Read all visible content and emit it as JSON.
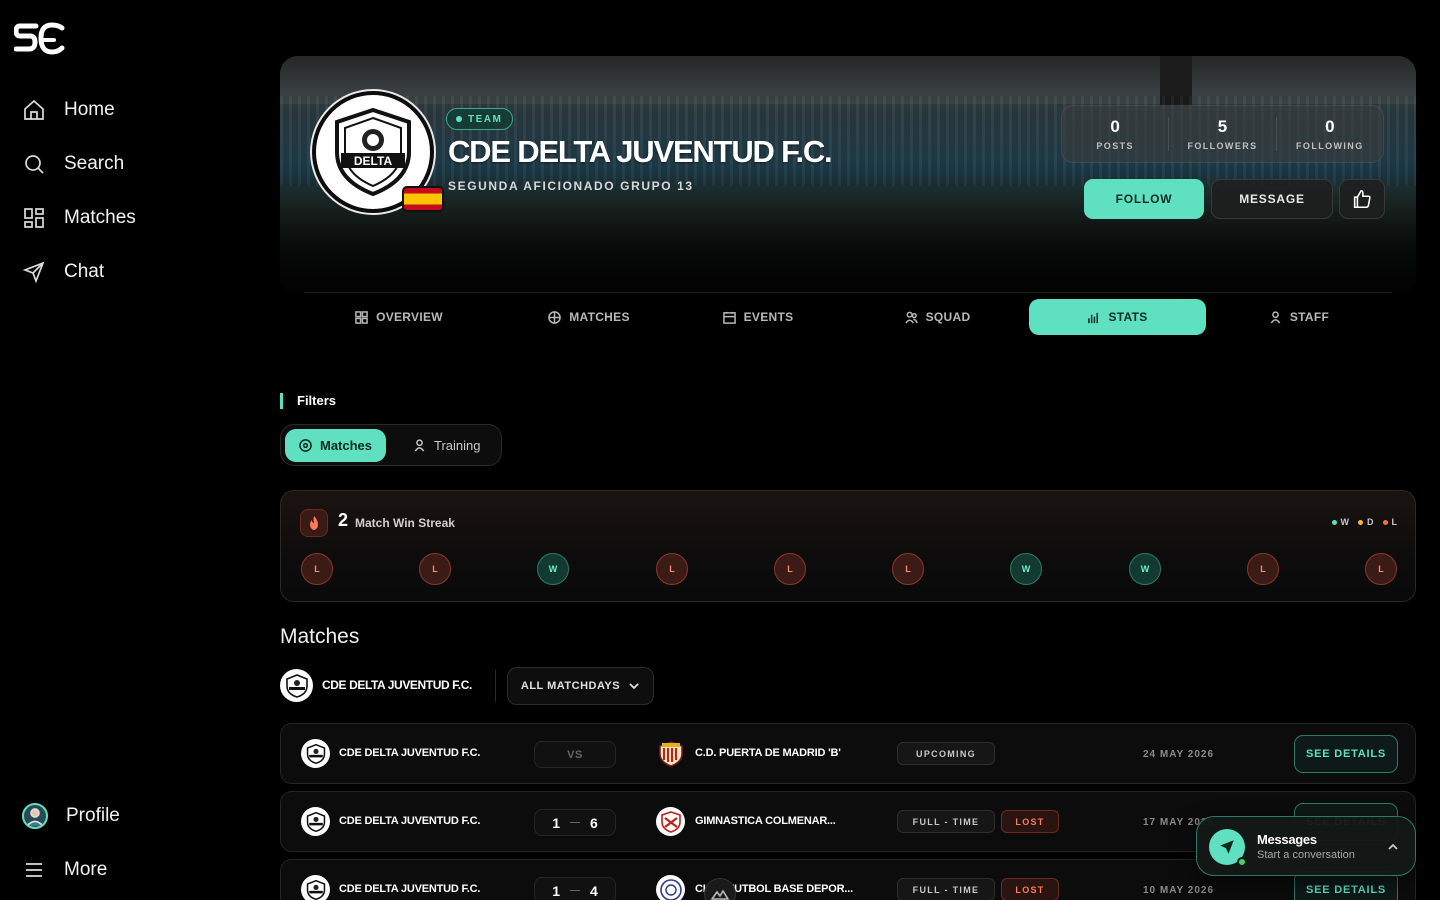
{
  "sidebar": {
    "nav": [
      {
        "label": "Home",
        "icon": "home-icon"
      },
      {
        "label": "Search",
        "icon": "search-icon"
      },
      {
        "label": "Matches",
        "icon": "grid-icon"
      },
      {
        "label": "Chat",
        "icon": "send-icon"
      }
    ],
    "profile_label": "Profile",
    "more_label": "More"
  },
  "team": {
    "badge": "TEAM",
    "name": "CDE DELTA JUVENTUD F.C.",
    "league": "SEGUNDA AFICIONADO GRUPO 13",
    "crest_text": "DELTA",
    "country_flag": "spain-flag",
    "stats": [
      {
        "value": "0",
        "label": "POSTS"
      },
      {
        "value": "5",
        "label": "FOLLOWERS"
      },
      {
        "value": "0",
        "label": "FOLLOWING"
      }
    ],
    "follow_label": "FOLLOW",
    "message_label": "MESSAGE"
  },
  "tabs": [
    {
      "label": "OVERVIEW",
      "icon": "grid-icon",
      "active": false
    },
    {
      "label": "MATCHES",
      "icon": "ball-icon",
      "active": false
    },
    {
      "label": "EVENTS",
      "icon": "calendar-icon",
      "active": false
    },
    {
      "label": "SQUAD",
      "icon": "users-icon",
      "active": false
    },
    {
      "label": "STATS",
      "icon": "bar-chart-icon",
      "active": true
    },
    {
      "label": "STAFF",
      "icon": "user-icon",
      "active": false
    }
  ],
  "filters": {
    "title": "Filters",
    "options": [
      {
        "label": "Matches",
        "active": true
      },
      {
        "label": "Training",
        "active": false
      }
    ]
  },
  "streak": {
    "count": "2",
    "label": "Match Win Streak",
    "legend": [
      {
        "label": "W",
        "color": "#5fe0c0"
      },
      {
        "label": "D",
        "color": "#f5b82e"
      },
      {
        "label": "L",
        "color": "#ff6b4a"
      }
    ],
    "results": [
      "L",
      "L",
      "W",
      "L",
      "L",
      "L",
      "W",
      "W",
      "L",
      "L"
    ]
  },
  "matches": {
    "title": "Matches",
    "team_name": "CDE DELTA JUVENTUD F.C.",
    "matchday_select": "ALL MATCHDAYS",
    "rows": [
      {
        "home": "CDE DELTA JUVENTUD F.C.",
        "score_type": "vs",
        "vs": "VS",
        "away": "C.D. PUERTA DE MADRID 'B'",
        "status": "UPCOMING",
        "result": "",
        "date": "24 MAY 2026",
        "details": "SEE DETAILS"
      },
      {
        "home": "CDE DELTA JUVENTUD F.C.",
        "score_type": "score",
        "home_goals": "1",
        "away_goals": "6",
        "away": "GIMNASTICA COLMENAR...",
        "status": "FULL - TIME",
        "result": "LOST",
        "date": "17 MAY 2026",
        "details": "SEE DETAILS"
      },
      {
        "home": "CDE DELTA JUVENTUD F.C.",
        "score_type": "score",
        "home_goals": "1",
        "away_goals": "4",
        "away": "CLUB FUTBOL BASE DEPOR...",
        "status": "FULL - TIME",
        "result": "LOST",
        "date": "10 MAY 2026",
        "details": "SEE DETAILS"
      }
    ]
  },
  "messages_widget": {
    "title": "Messages",
    "subtitle": "Start a conversation"
  }
}
